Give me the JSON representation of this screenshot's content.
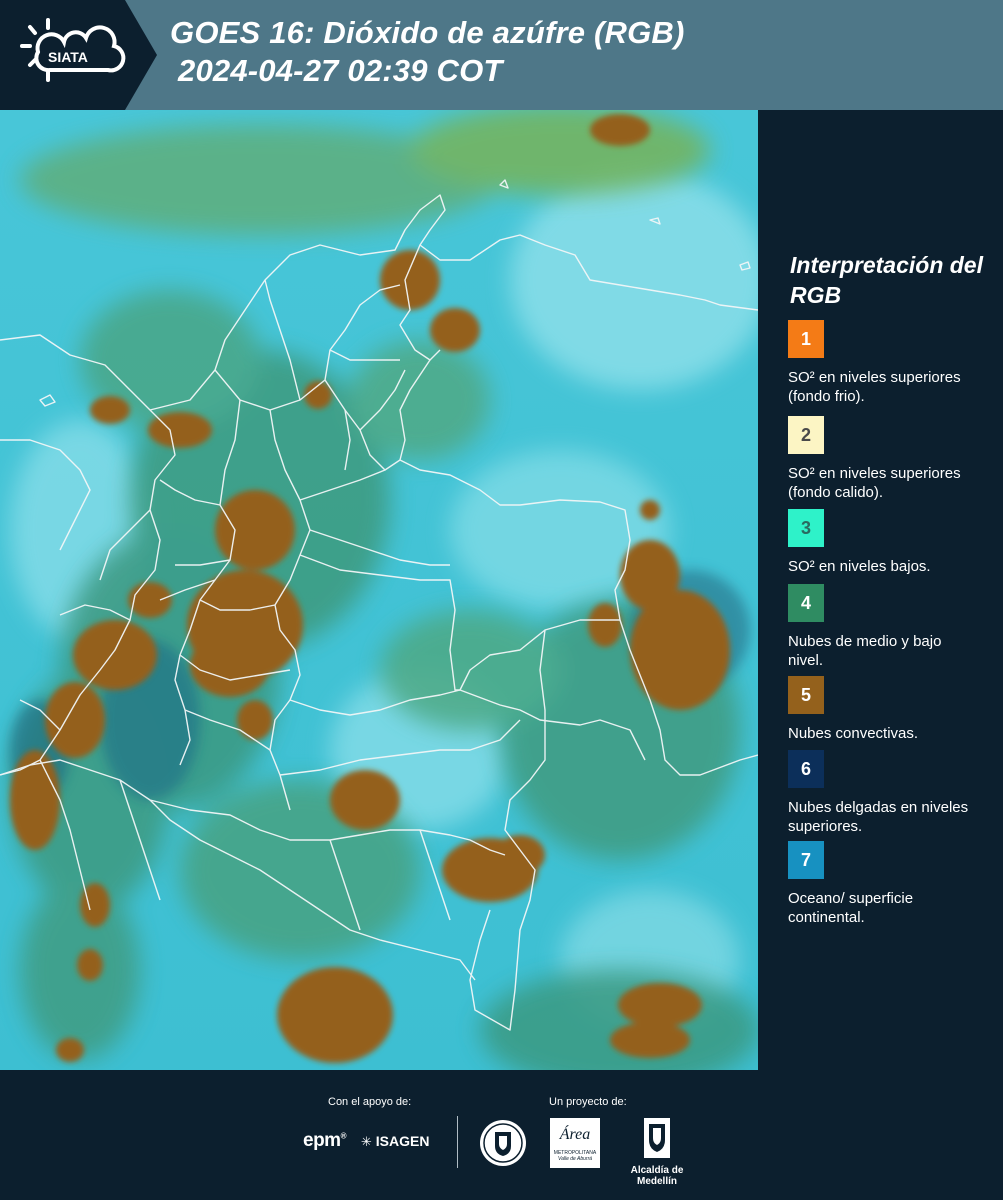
{
  "header": {
    "logo_text": "SIATA",
    "title_line1": "GOES 16: Dióxido de azúfre (RGB)",
    "title_line2": "2024-04-27 02:39 COT"
  },
  "legend": {
    "title": "Interpretación del RGB",
    "items": [
      {
        "number": "1",
        "label": "SO² en niveles superiores (fondo frio).",
        "color": "#f47b16",
        "text_color": "#ffffff"
      },
      {
        "number": "2",
        "label": "SO² en niveles superiores (fondo calido).",
        "color": "#fcf5c4",
        "text_color": "#4a4a4a"
      },
      {
        "number": "3",
        "label": "SO² en niveles bajos.",
        "color": "#2ef2c9",
        "text_color": "#2a6a60"
      },
      {
        "number": "4",
        "label": "Nubes de medio y bajo nivel.",
        "color": "#2f8c62",
        "text_color": "#ffffff"
      },
      {
        "number": "5",
        "label": "Nubes convectivas.",
        "color": "#94611c",
        "text_color": "#ffffff"
      },
      {
        "number": "6",
        "label": "Nubes delgadas en niveles superiores.",
        "color": "#0c2f5a",
        "text_color": "#ffffff"
      },
      {
        "number": "7",
        "label": "Oceano/ superficie continental.",
        "color": "#1791c1",
        "text_color": "#ffffff"
      }
    ]
  },
  "footer": {
    "support_label": "Con el apoyo de:",
    "project_label": "Un proyecto de:",
    "sponsor_epm": "epm",
    "sponsor_isagen": "ISAGEN",
    "partner_area_name": "Área",
    "partner_area_line1": "METROPOLITANA",
    "partner_area_line2": "Valle de Aburrá",
    "partner_medellin": "Alcaldía de Medellín"
  },
  "colors": {
    "header_bg": "#4e7788",
    "panel_bg": "#0c1f2e",
    "sky_cyan": "#3fc4d6",
    "cloud_convective": "#94611c",
    "cloud_mid": "#3b9a83"
  }
}
